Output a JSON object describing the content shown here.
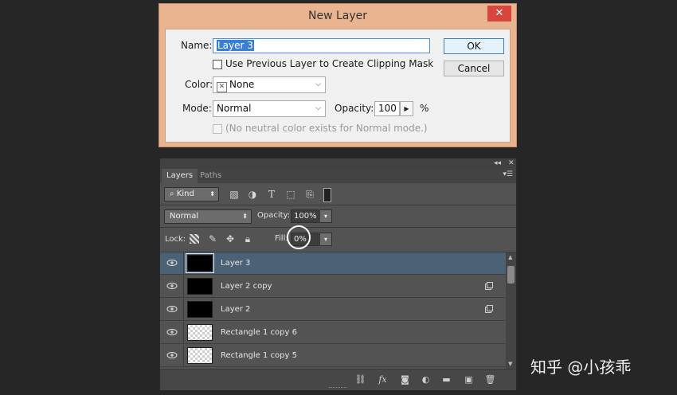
{
  "dialog": {
    "title": "New Layer",
    "close_glyph": "✕",
    "name_label": "Name:",
    "name_value": "Layer 3",
    "clip_label": "Use Previous Layer to Create Clipping Mask",
    "color_label": "Color:",
    "color_value": "None",
    "mode_label": "Mode:",
    "mode_value": "Normal",
    "opacity_label": "Opacity:",
    "opacity_value": "100",
    "opacity_unit": "%",
    "neutral_label": "(No neutral color exists for Normal mode.)",
    "ok_label": "OK",
    "cancel_label": "Cancel"
  },
  "panel": {
    "tabs": [
      "Layers",
      "Paths"
    ],
    "filter_value": "Kind",
    "blend_mode": "Normal",
    "opacity_label": "Opacity:",
    "opacity_value": "100%",
    "lock_label": "Lock:",
    "fill_label": "Fill:",
    "fill_value": "0%",
    "filter_icons": [
      "image-filter-icon",
      "adjustment-filter-icon",
      "type-filter-icon",
      "shape-filter-icon",
      "smart-object-filter-icon",
      "filter-toggle-icon"
    ],
    "lock_icons": [
      "lock-transparent-icon",
      "lock-image-icon",
      "lock-position-icon",
      "lock-all-icon"
    ],
    "bottom_icons": [
      "link-layers-icon",
      "fx-icon",
      "layer-mask-icon",
      "adjustment-layer-icon",
      "group-folder-icon",
      "new-layer-icon",
      "trash-icon"
    ],
    "bottom_fx_label": "fx",
    "layers": [
      {
        "name": "Layer 3",
        "thumb": "black",
        "selected": true,
        "smart": false
      },
      {
        "name": "Layer 2 copy",
        "thumb": "black",
        "selected": false,
        "smart": true
      },
      {
        "name": "Layer 2",
        "thumb": "black",
        "selected": false,
        "smart": true
      },
      {
        "name": "Rectangle 1 copy 6",
        "thumb": "checker",
        "selected": false,
        "smart": false
      },
      {
        "name": "Rectangle 1 copy 5",
        "thumb": "checker",
        "selected": false,
        "smart": false
      }
    ]
  },
  "watermark": "知乎 @小孩乖",
  "colors": {
    "dialog_frame": "#e9b48f",
    "dialog_body": "#f0f0f0",
    "panel_bg": "#535353",
    "selected_row": "#4b6175",
    "page_bg": "#262626"
  }
}
